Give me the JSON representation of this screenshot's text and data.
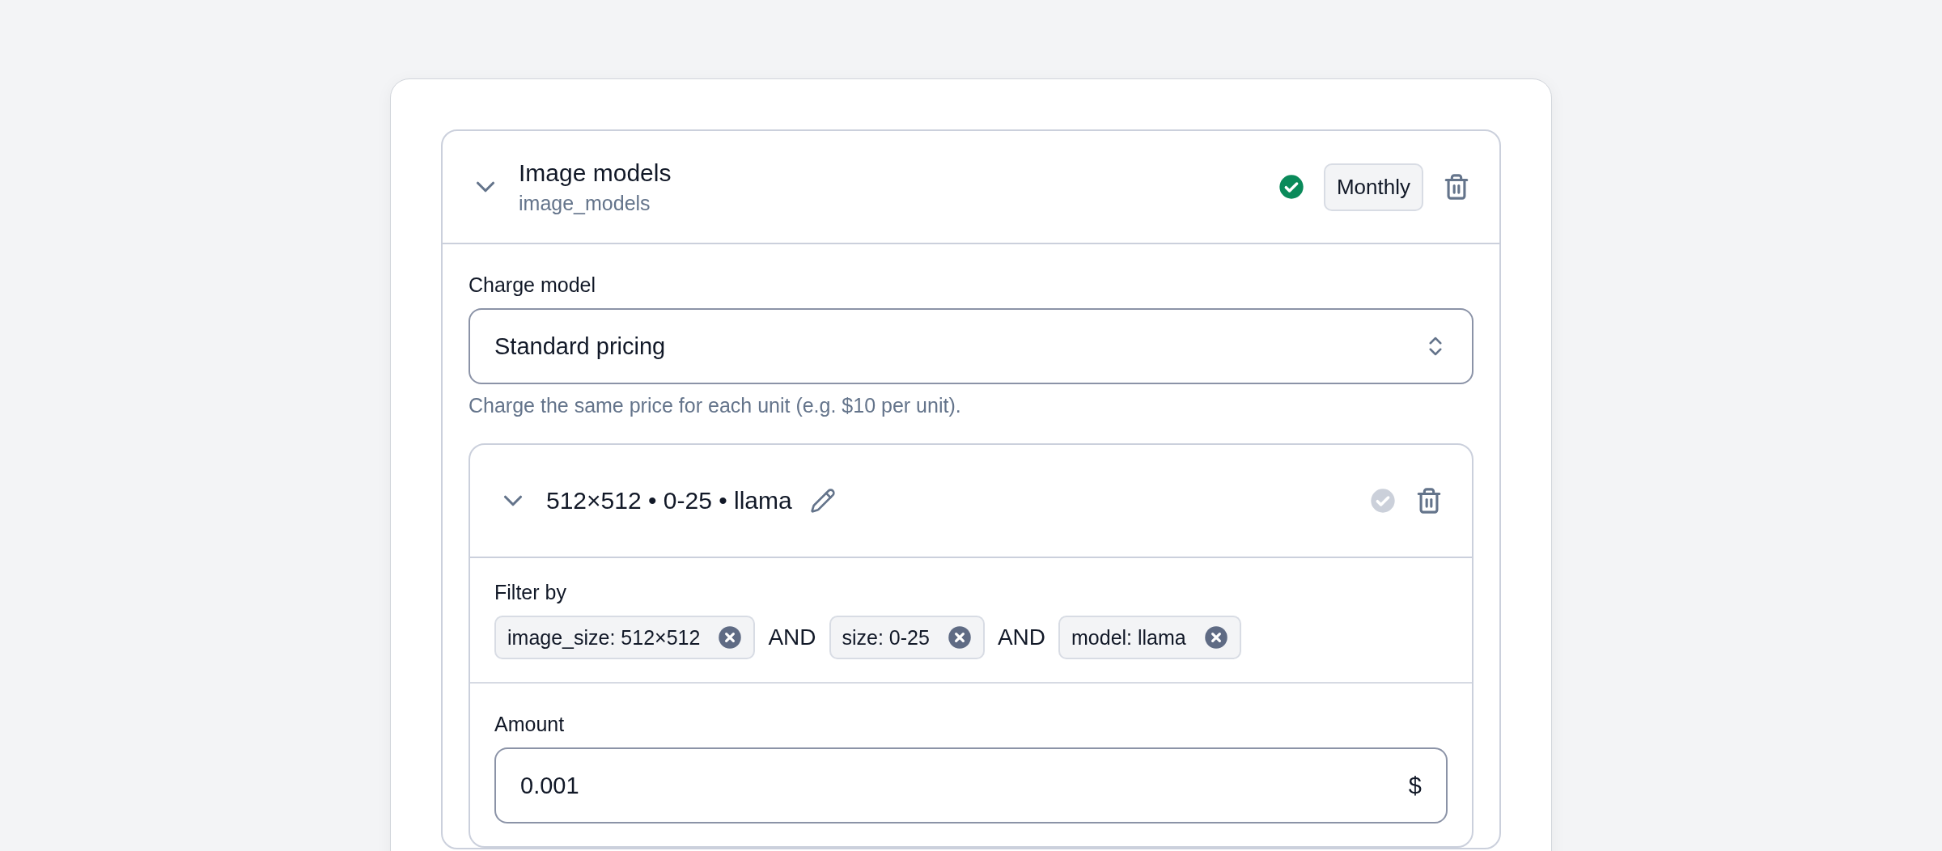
{
  "section": {
    "title": "Image models",
    "code": "image_models",
    "expanded": true,
    "valid": true,
    "interval": "Monthly",
    "charge_model": {
      "label": "Charge model",
      "value": "Standard pricing",
      "help": "Charge the same price for each unit (e.g. $10 per unit)."
    },
    "rule": {
      "title": "512×512 • 0-25 • llama",
      "expanded": true,
      "valid": false,
      "filter": {
        "label": "Filter by",
        "chips": [
          "image_size: 512×512",
          "size: 0-25",
          "model: llama"
        ],
        "joiners": [
          "AND",
          "AND"
        ]
      },
      "amount": {
        "label": "Amount",
        "value": "0.001",
        "suffix": "$"
      }
    }
  }
}
